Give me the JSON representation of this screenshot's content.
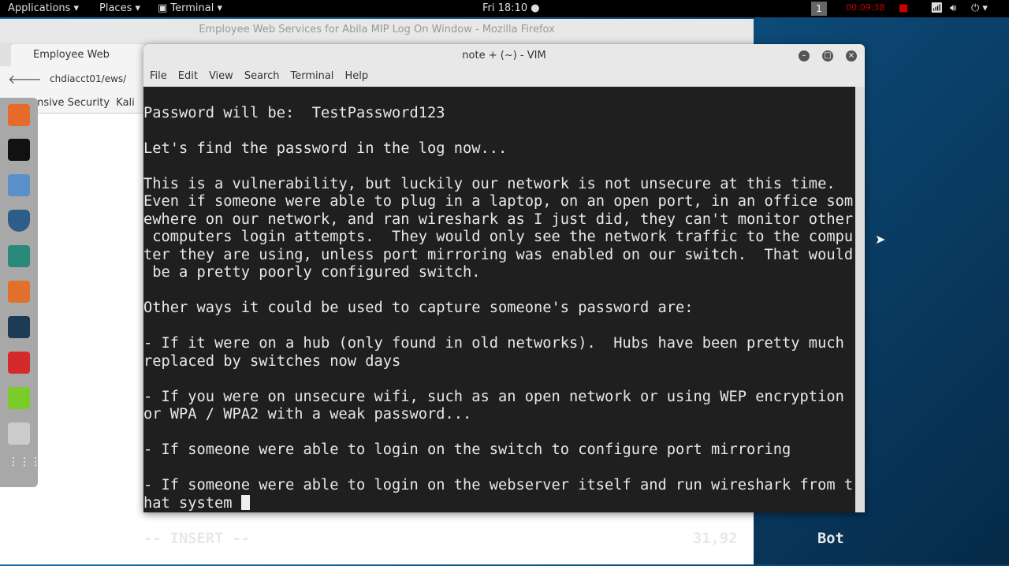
{
  "topbar": {
    "applications": "Applications ▾",
    "places": "Places ▾",
    "terminal": "Terminal ▾",
    "clock": "Fri 18:10 ●",
    "workspace": "1",
    "recording_timer": "00:09:38"
  },
  "firefox": {
    "title": "Employee Web Services for Abila MIP Log On Window - Mozilla Firefox",
    "tab": "Employee Web Servic...",
    "url": "chdiacct01/ews/",
    "bookmarks": [
      "Offensive Security",
      "Kali"
    ]
  },
  "dock": {
    "apps": [
      "firefox",
      "terminal",
      "files",
      "metasploit",
      "armitage",
      "burpsuite",
      "maltego",
      "faraday",
      "notes",
      "screenshot",
      "show-apps"
    ]
  },
  "vim": {
    "title": "note + (~) - VIM",
    "menu": [
      "File",
      "Edit",
      "View",
      "Search",
      "Terminal",
      "Help"
    ],
    "lines": [
      "Password will be:  TestPassword123",
      "",
      "Let's find the password in the log now...",
      "",
      "This is a vulnerability, but luckily our network is not unsecure at this time.",
      "Even if someone were able to plug in a laptop, on an open port, in an office som",
      "ewhere on our network, and ran wireshark as I just did, they can't monitor other",
      " computers login attempts.  They would only see the network traffic to the compu",
      "ter they are using, unless port mirroring was enabled on our switch.  That would",
      " be a pretty poorly configured switch.",
      "",
      "Other ways it could be used to capture someone's password are:",
      "",
      "- If it were on a hub (only found in old networks).  Hubs have been pretty much",
      "replaced by switches now days",
      "",
      "- If you were on unsecure wifi, such as an open network or using WEP encryption",
      "or WPA / WPA2 with a weak password...",
      "",
      "- If someone were able to login on the switch to configure port mirroring",
      "",
      "- If someone were able to login on the webserver itself and run wireshark from t",
      "hat system "
    ],
    "mode": "-- INSERT --",
    "position": "31,92",
    "scroll": "Bot"
  }
}
